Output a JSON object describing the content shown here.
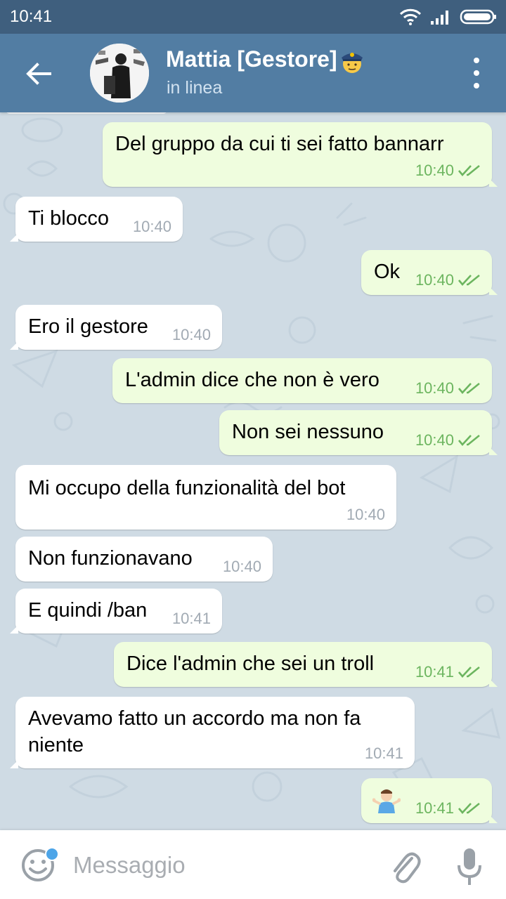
{
  "status_bar": {
    "time": "10:41"
  },
  "header": {
    "title": "Mattia [Gestore]",
    "status": "in linea",
    "title_emoji": "police-officer-emoji"
  },
  "messages": [
    {
      "direction": "out",
      "text": "Del gruppo da cui ti sei fatto bannarr",
      "time": "10:40",
      "read": true
    },
    {
      "direction": "in",
      "text": "Ti blocco",
      "time": "10:40"
    },
    {
      "direction": "out",
      "text": "Ok",
      "time": "10:40",
      "read": true
    },
    {
      "direction": "in",
      "text": "Ero il gestore",
      "time": "10:40"
    },
    {
      "direction": "out",
      "text": "L'admin dice che non è vero",
      "time": "10:40",
      "read": true
    },
    {
      "direction": "out",
      "text": "Non sei nessuno",
      "time": "10:40",
      "read": true
    },
    {
      "direction": "in",
      "text": "Mi occupo della funzionalità del bot",
      "time": "10:40"
    },
    {
      "direction": "in",
      "text": "Non funzionavano",
      "time": "10:40"
    },
    {
      "direction": "in",
      "text": "E quindi /ban",
      "time": "10:41"
    },
    {
      "direction": "out",
      "text": "Dice l'admin che sei un troll",
      "time": "10:41",
      "read": true
    },
    {
      "direction": "in",
      "text_line1": "Avevamo fatto un accordo ma non fa",
      "text_line2": "niente",
      "time": "10:41"
    },
    {
      "direction": "out",
      "emoji": "shrugging-man-emoji",
      "time": "10:41",
      "read": true
    }
  ],
  "input": {
    "placeholder": "Messaggio",
    "value": ""
  },
  "colors": {
    "status_bar": "#3f5f7e",
    "header": "#527da3",
    "chat_background": "#cfdbe4",
    "outgoing_bubble": "#effdde",
    "incoming_bubble": "#ffffff",
    "read_check": "#6cb55f",
    "unread_dot": "#4da5e8"
  },
  "icons": {
    "back": "arrow-left-icon",
    "menu": "more-vert-icon",
    "wifi": "wifi-icon",
    "signal": "signal-icon",
    "battery": "battery-icon",
    "emoji": "emoji-icon",
    "attach": "paperclip-icon",
    "mic": "mic-icon",
    "read": "double-check-icon"
  }
}
